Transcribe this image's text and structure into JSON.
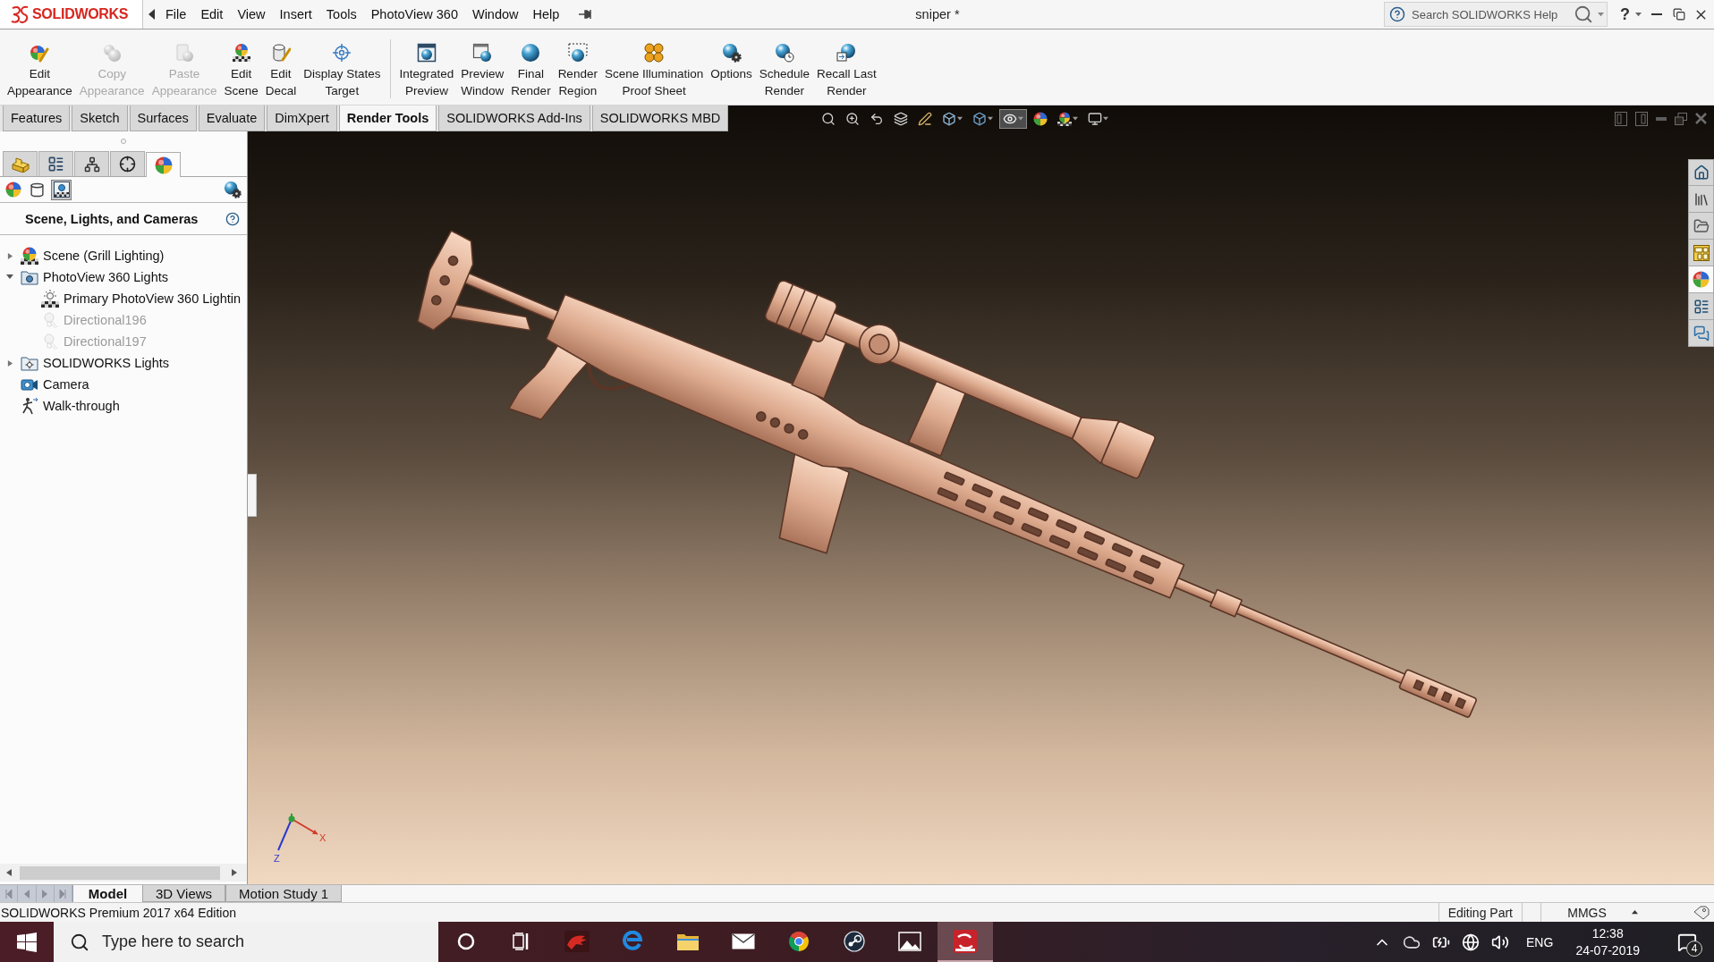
{
  "title_bar": {
    "logo": "SOLIDWORKS",
    "menu": [
      "File",
      "Edit",
      "View",
      "Insert",
      "Tools",
      "PhotoView 360",
      "Window",
      "Help"
    ],
    "document_title": "sniper *",
    "help_search": {
      "placeholder": "Search SOLIDWORKS Help"
    },
    "help_label": "?"
  },
  "command_manager": {
    "groups": [
      [
        {
          "kind": "edit-appearance",
          "lines": [
            "Edit",
            "Appearance"
          ],
          "disabled": false
        },
        {
          "kind": "copy-appearance",
          "lines": [
            "Copy",
            "Appearance"
          ],
          "disabled": true
        },
        {
          "kind": "paste-appearance",
          "lines": [
            "Paste",
            "Appearance"
          ],
          "disabled": true
        },
        {
          "kind": "edit-scene",
          "lines": [
            "Edit",
            "Scene"
          ],
          "disabled": false
        },
        {
          "kind": "edit-decal",
          "lines": [
            "Edit",
            "Decal"
          ],
          "disabled": false
        },
        {
          "kind": "target",
          "lines": [
            "Display States",
            "Target"
          ],
          "disabled": false
        }
      ],
      [
        {
          "kind": "integrated-preview",
          "lines": [
            "Integrated",
            "Preview"
          ],
          "disabled": false
        },
        {
          "kind": "preview-window",
          "lines": [
            "Preview",
            "Window"
          ],
          "disabled": false
        },
        {
          "kind": "final-render",
          "lines": [
            "Final",
            "Render"
          ],
          "disabled": false
        },
        {
          "kind": "render-region",
          "lines": [
            "Render",
            "Region"
          ],
          "disabled": false
        },
        {
          "kind": "proof-sheet",
          "lines": [
            "Scene Illumination",
            "Proof Sheet"
          ],
          "disabled": false
        },
        {
          "kind": "options",
          "lines": [
            "Options"
          ],
          "disabled": false
        },
        {
          "kind": "schedule",
          "lines": [
            "Schedule",
            "Render"
          ],
          "disabled": false
        },
        {
          "kind": "recall",
          "lines": [
            "Recall Last",
            "Render"
          ],
          "disabled": false
        }
      ]
    ]
  },
  "command_tabs": [
    {
      "label": "Features",
      "selected": false
    },
    {
      "label": "Sketch",
      "selected": false
    },
    {
      "label": "Surfaces",
      "selected": false
    },
    {
      "label": "Evaluate",
      "selected": false
    },
    {
      "label": "DimXpert",
      "selected": false
    },
    {
      "label": "Render Tools",
      "selected": true
    },
    {
      "label": "SOLIDWORKS Add-Ins",
      "selected": false
    },
    {
      "label": "SOLIDWORKS MBD",
      "selected": false
    }
  ],
  "view_toolbar": [
    {
      "kind": "zoom-fit",
      "dropdown": false,
      "selected": false
    },
    {
      "kind": "zoom-area",
      "dropdown": false,
      "selected": false
    },
    {
      "kind": "previous-view",
      "dropdown": false,
      "selected": false
    },
    {
      "kind": "section-view",
      "dropdown": false,
      "selected": false
    },
    {
      "kind": "annotation",
      "dropdown": false,
      "selected": false
    },
    {
      "kind": "view-orientation",
      "dropdown": true,
      "selected": false
    },
    {
      "kind": "display-style",
      "dropdown": true,
      "selected": false
    },
    {
      "kind": "hide-show",
      "dropdown": true,
      "selected": true
    },
    {
      "kind": "appearance",
      "dropdown": false,
      "selected": false
    },
    {
      "kind": "scene",
      "dropdown": true,
      "selected": false
    },
    {
      "kind": "view-settings",
      "dropdown": true,
      "selected": false
    }
  ],
  "panel": {
    "tabs": [
      {
        "kind": "features",
        "selected": false
      },
      {
        "kind": "properties",
        "selected": false
      },
      {
        "kind": "configurations",
        "selected": false
      },
      {
        "kind": "dimxpert",
        "selected": false
      },
      {
        "kind": "display",
        "selected": true
      }
    ],
    "subtabs": [
      {
        "kind": "appearances",
        "selected": false
      },
      {
        "kind": "decals",
        "selected": false
      },
      {
        "kind": "scenes",
        "selected": true
      }
    ],
    "title": "Scene, Lights, and Cameras",
    "tree": [
      {
        "label": "Scene (Grill Lighting)",
        "kind": "scene",
        "expanded": false,
        "disabled": false
      },
      {
        "label": "PhotoView 360 Lights",
        "kind": "light-folder",
        "expanded": true,
        "disabled": false,
        "children": [
          {
            "label": "Primary PhotoView 360 Lightin",
            "kind": "primary-light",
            "disabled": false
          },
          {
            "label": "Directional196",
            "kind": "directional-light",
            "disabled": true
          },
          {
            "label": "Directional197",
            "kind": "directional-light",
            "disabled": true
          }
        ]
      },
      {
        "label": "SOLIDWORKS Lights",
        "kind": "sw-light-folder",
        "expanded": false,
        "disabled": false
      },
      {
        "label": "Camera",
        "kind": "camera",
        "disabled": false
      },
      {
        "label": "Walk-through",
        "kind": "walkthrough",
        "disabled": false
      }
    ]
  },
  "viewport": {
    "triad": {
      "x_label": "X",
      "z_label": "Z"
    }
  },
  "task_pane": [
    {
      "kind": "home",
      "selected": false
    },
    {
      "kind": "library",
      "selected": false
    },
    {
      "kind": "explorer",
      "selected": false
    },
    {
      "kind": "view-palette",
      "selected": false
    },
    {
      "kind": "appearances",
      "selected": true
    },
    {
      "kind": "properties",
      "selected": false
    },
    {
      "kind": "forum",
      "selected": false
    }
  ],
  "bottom_tabs": [
    {
      "label": "Model",
      "selected": true
    },
    {
      "label": "3D Views",
      "selected": false
    },
    {
      "label": "Motion Study 1",
      "selected": false
    }
  ],
  "status_bar": {
    "edition": "SOLIDWORKS Premium 2017 x64 Edition",
    "mode": "Editing Part",
    "units": "MMGS"
  },
  "taskbar": {
    "search": {
      "placeholder": "Type here to search"
    },
    "apps": [
      {
        "kind": "ring",
        "selected": false
      },
      {
        "kind": "task-view",
        "selected": false
      },
      {
        "kind": "dragon",
        "selected": false
      },
      {
        "kind": "e-logo",
        "selected": false
      },
      {
        "kind": "folder",
        "selected": false
      },
      {
        "kind": "envelope",
        "selected": false
      },
      {
        "kind": "segmented-circle",
        "selected": false
      },
      {
        "kind": "lever-circle",
        "selected": false
      },
      {
        "kind": "landscape",
        "selected": false
      },
      {
        "kind": "app-tile",
        "selected": true
      }
    ],
    "tray": {
      "language": "ENG",
      "time": "12:38",
      "date": "24-07-2019",
      "notifications": "4"
    }
  }
}
